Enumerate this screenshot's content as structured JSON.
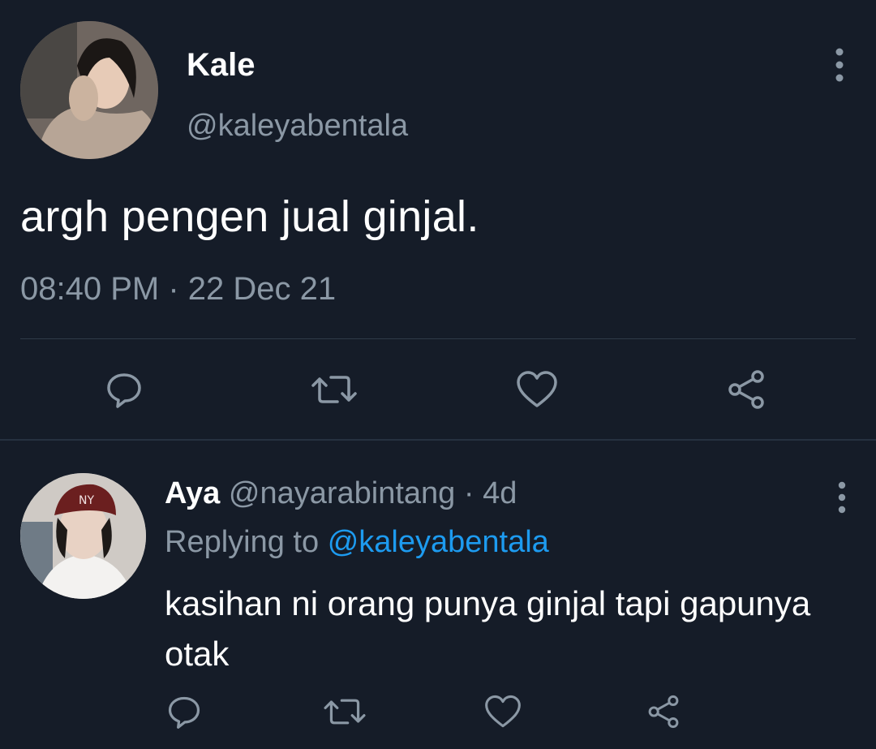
{
  "main_tweet": {
    "display_name": "Kale",
    "handle": "@kaleyabentala",
    "text": "argh pengen jual ginjal.",
    "timestamp": "08:40 PM · 22 Dec 21",
    "icons": {
      "more": "more-vertical-icon",
      "reply": "reply-icon",
      "retweet": "retweet-icon",
      "like": "heart-icon",
      "share": "share-icon"
    }
  },
  "reply_tweet": {
    "display_name": "Aya",
    "handle": "@nayarabintang",
    "separator": "·",
    "age": "4d",
    "replying_label": "Replying to",
    "replying_handle": "@kaleyabentala",
    "text": "kasihan ni orang punya ginjal tapi gapunya otak"
  },
  "colors": {
    "background": "#151c28",
    "primary_text": "#ffffff",
    "secondary_text": "#8b98a5",
    "accent": "#1d9bf0",
    "divider": "#2f3a47"
  }
}
